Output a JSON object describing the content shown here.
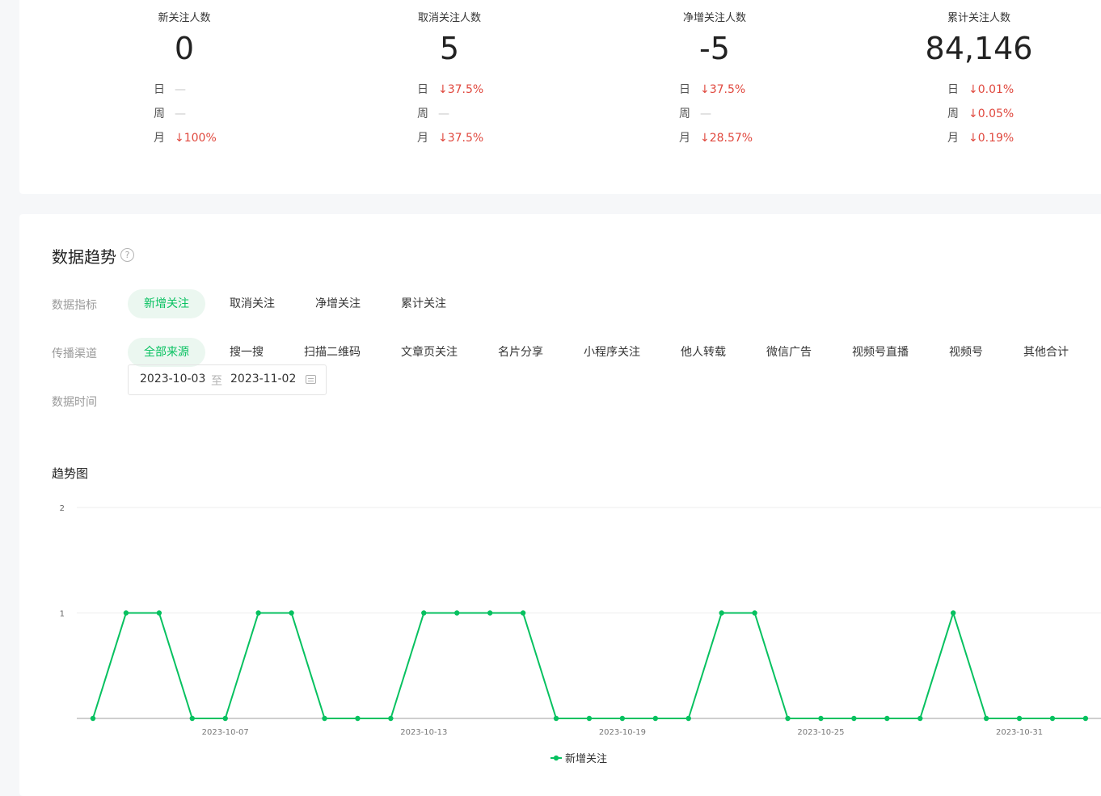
{
  "stats": [
    {
      "label": "新关注人数",
      "value": "0",
      "rows": [
        {
          "key": "日",
          "val": "—",
          "dir": ""
        },
        {
          "key": "周",
          "val": "—",
          "dir": ""
        },
        {
          "key": "月",
          "val": "100%",
          "dir": "down"
        }
      ]
    },
    {
      "label": "取消关注人数",
      "value": "5",
      "rows": [
        {
          "key": "日",
          "val": "37.5%",
          "dir": "down"
        },
        {
          "key": "周",
          "val": "—",
          "dir": ""
        },
        {
          "key": "月",
          "val": "37.5%",
          "dir": "down"
        }
      ]
    },
    {
      "label": "净增关注人数",
      "value": "-5",
      "rows": [
        {
          "key": "日",
          "val": "37.5%",
          "dir": "down"
        },
        {
          "key": "周",
          "val": "—",
          "dir": ""
        },
        {
          "key": "月",
          "val": "28.57%",
          "dir": "down"
        }
      ]
    },
    {
      "label": "累计关注人数",
      "value": "84,146",
      "rows": [
        {
          "key": "日",
          "val": "0.01%",
          "dir": "down"
        },
        {
          "key": "周",
          "val": "0.05%",
          "dir": "down"
        },
        {
          "key": "月",
          "val": "0.19%",
          "dir": "down"
        }
      ]
    }
  ],
  "trend": {
    "title": "数据趋势",
    "help_icon": "?",
    "metrics_label": "数据指标",
    "metrics": [
      "新增关注",
      "取消关注",
      "净增关注",
      "累计关注"
    ],
    "metrics_active": 0,
    "channels_label": "传播渠道",
    "channels": [
      "全部来源",
      "搜一搜",
      "扫描二维码",
      "文章页关注",
      "名片分享",
      "小程序关注",
      "他人转载",
      "微信广告",
      "视频号直播",
      "视频号",
      "其他合计"
    ],
    "channels_active": 0,
    "time_label": "数据时间",
    "date_start": "2023-10-03",
    "date_sep": "至",
    "date_end": "2023-11-02",
    "chart_title": "趋势图",
    "accent": "#07c160",
    "down_color": "#e0483e"
  },
  "chart_data": {
    "type": "line",
    "ylim": [
      0,
      2
    ],
    "y_ticks": [
      "2",
      "1"
    ],
    "x_tick_labels": [
      "2023-10-07",
      "2023-10-13",
      "2023-10-19",
      "2023-10-25",
      "2023-10-31"
    ],
    "x": [
      "2023-10-03",
      "2023-10-04",
      "2023-10-05",
      "2023-10-06",
      "2023-10-07",
      "2023-10-08",
      "2023-10-09",
      "2023-10-10",
      "2023-10-11",
      "2023-10-12",
      "2023-10-13",
      "2023-10-14",
      "2023-10-15",
      "2023-10-16",
      "2023-10-17",
      "2023-10-18",
      "2023-10-19",
      "2023-10-20",
      "2023-10-21",
      "2023-10-22",
      "2023-10-23",
      "2023-10-24",
      "2023-10-25",
      "2023-10-26",
      "2023-10-27",
      "2023-10-28",
      "2023-10-29",
      "2023-10-30",
      "2023-10-31",
      "2023-11-01",
      "2023-11-02"
    ],
    "series": [
      {
        "name": "新增关注",
        "color": "#07c160",
        "values": [
          0,
          1,
          1,
          0,
          0,
          1,
          1,
          0,
          0,
          0,
          1,
          1,
          1,
          1,
          0,
          0,
          0,
          0,
          0,
          1,
          1,
          0,
          0,
          0,
          0,
          0,
          1,
          0,
          0,
          0,
          0
        ]
      }
    ],
    "legend_position": "bottom-center",
    "grid": true
  }
}
